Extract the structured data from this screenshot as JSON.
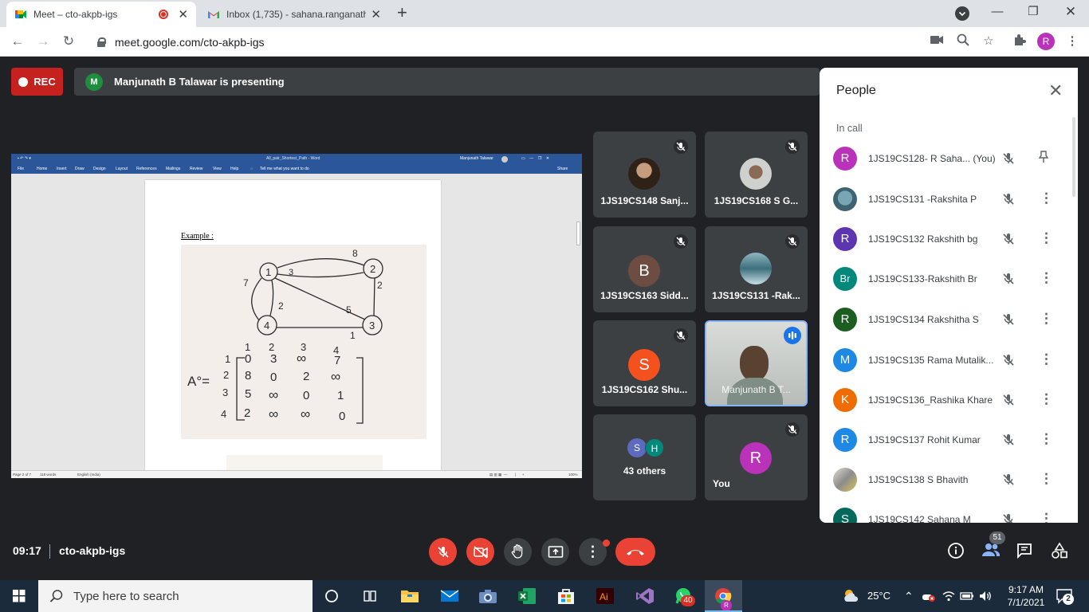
{
  "browser": {
    "tabs": [
      {
        "title": "Meet – cto-akpb-igs",
        "active": true
      },
      {
        "title": "Inbox (1,735) - sahana.ranganath",
        "active": false
      }
    ],
    "url": "meet.google.com/cto-akpb-igs",
    "profile_initial": "R"
  },
  "meet": {
    "rec_label": "REC",
    "presenter_initial": "M",
    "presenting_text": "Manjunath B Talawar is presenting",
    "meeting_time": "09:17",
    "meeting_code": "cto-akpb-igs",
    "people_count": "51"
  },
  "presentation": {
    "word_title": "All_pair_Shortest_Path - Word",
    "word_user": "Manjunath Talawar",
    "ribbon_tabs": [
      "File",
      "Home",
      "Insert",
      "Draw",
      "Design",
      "Layout",
      "References",
      "Mailings",
      "Review",
      "View",
      "Help"
    ],
    "tell_me": "Tell me what you want to do",
    "share": "Share",
    "example_heading": "Example :",
    "status_page": "Page 2 of 7",
    "status_words": "118 words",
    "status_lang": "English (India)",
    "status_zoom": "100%",
    "graph": {
      "nodes": [
        "1",
        "2",
        "3",
        "4"
      ],
      "edges": [
        {
          "from": "1",
          "to": "2",
          "weight": "3"
        },
        {
          "from": "2",
          "to": "1",
          "weight": "8"
        },
        {
          "from": "2",
          "to": "3",
          "weight": "2"
        },
        {
          "from": "3",
          "to": "1",
          "weight": "5"
        },
        {
          "from": "3",
          "to": "4",
          "weight": "1"
        },
        {
          "from": "4",
          "to": "1",
          "weight": "2"
        },
        {
          "from": "1",
          "to": "4",
          "weight": "7"
        }
      ]
    },
    "matrix": {
      "label": "A°=",
      "col_headers": [
        "1",
        "2",
        "3",
        "4"
      ],
      "row_headers": [
        "1",
        "2",
        "3",
        "4"
      ],
      "rows": [
        [
          "0",
          "3",
          "∞",
          "7"
        ],
        [
          "8",
          "0",
          "2",
          "∞"
        ],
        [
          "5",
          "∞",
          "0",
          "1"
        ],
        [
          "2",
          "∞",
          "∞",
          "0"
        ]
      ]
    }
  },
  "tiles": [
    {
      "name": "1JS19CS148 Sanj...",
      "avatar": "photo",
      "muted": true
    },
    {
      "name": "1JS19CS168 S G...",
      "avatar": "photo",
      "muted": true
    },
    {
      "name": "1JS19CS163 Sidd...",
      "avatar": "B",
      "color": "#6d4c41",
      "muted": true
    },
    {
      "name": "1JS19CS131 -Rak...",
      "avatar": "photo",
      "muted": true
    },
    {
      "name": "1JS19CS162 Shu...",
      "avatar": "S",
      "color": "#f4511e",
      "muted": true
    },
    {
      "name": "Manjunath B T...",
      "avatar": "video",
      "speaking": true
    },
    {
      "name": "43 others",
      "avatars": [
        "S",
        "H"
      ]
    },
    {
      "name": "You",
      "avatar": "R",
      "color": "#b932b9",
      "muted": true
    }
  ],
  "people": {
    "title": "People",
    "section": "In call",
    "list": [
      {
        "name": "1JS19CS128- R Saha...  (You)",
        "initial": "R",
        "color": "#b932b9",
        "action": "pin-icon"
      },
      {
        "name": "1JS19CS131 -Rakshita P",
        "initial": "",
        "color": "#4a7a8a",
        "action": "more-icon"
      },
      {
        "name": "1JS19CS132 Rakshith bg",
        "initial": "R",
        "color": "#5e35b1",
        "action": "more-icon"
      },
      {
        "name": "1JS19CS133-Rakshith Br",
        "initial": "Br",
        "color": "#00897b",
        "action": "more-icon"
      },
      {
        "name": "1JS19CS134 Rakshitha S",
        "initial": "R",
        "color": "#1b5e20",
        "action": "more-icon"
      },
      {
        "name": "1JS19CS135 Rama Mutalik...",
        "initial": "M",
        "color": "#1e88e5",
        "action": "more-icon"
      },
      {
        "name": "1JS19CS136_Rashika Khare",
        "initial": "K",
        "color": "#ef6c00",
        "action": "more-icon"
      },
      {
        "name": "1JS19CS137 Rohit Kumar",
        "initial": "R",
        "color": "#1e88e5",
        "action": "more-icon"
      },
      {
        "name": "1JS19CS138 S Bhavith",
        "initial": "",
        "color": "#9e9e9e",
        "action": "more-icon"
      },
      {
        "name": "1JS19CS142 Sahana M",
        "initial": "S",
        "color": "#00695c",
        "action": "more-icon"
      }
    ]
  },
  "taskbar": {
    "search_placeholder": "Type here to search",
    "whatsapp_badge": "40",
    "temperature": "25°C",
    "time": "9:17 AM",
    "date": "7/1/2021",
    "notification_count": "2"
  },
  "colors": {
    "meet_bg": "#202124",
    "tile_bg": "#3c4043",
    "danger": "#ea4335",
    "rec": "#c5221f",
    "word_blue": "#2b579a"
  }
}
